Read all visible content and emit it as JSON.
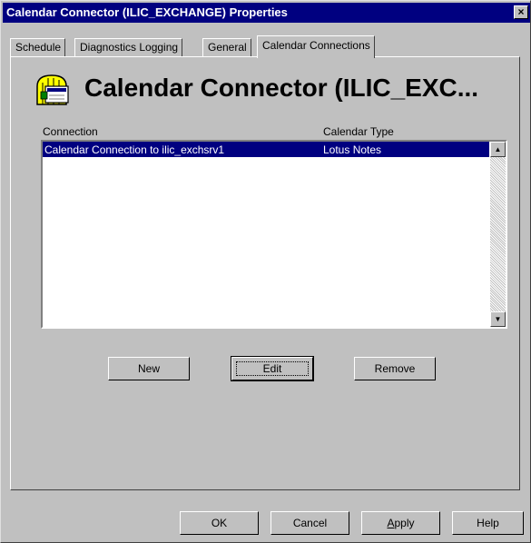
{
  "window": {
    "title": "Calendar Connector (ILIC_EXCHANGE) Properties",
    "close_glyph": "×"
  },
  "tabs": [
    {
      "label": "Schedule"
    },
    {
      "label": "Diagnostics Logging"
    },
    {
      "label": "General"
    },
    {
      "label": "Calendar Connections",
      "active": true
    }
  ],
  "header": {
    "title": "Calendar Connector (ILIC_EXC...",
    "icon": "calendar-connector-icon"
  },
  "list": {
    "columns": [
      "Connection",
      "Calendar Type"
    ],
    "rows": [
      {
        "connection": "Calendar Connection to ilic_exchsrv1",
        "type": "Lotus Notes",
        "selected": true
      }
    ],
    "scroll_up": "▲",
    "scroll_down": "▼"
  },
  "actions": {
    "new": "New",
    "edit": "Edit",
    "remove": "Remove"
  },
  "footer": {
    "ok": "OK",
    "cancel": "Cancel",
    "apply_accel": "A",
    "apply_rest": "pply",
    "help": "Help"
  },
  "colors": {
    "titlebar": "#000080",
    "face": "#c0c0c0",
    "selection": "#000080"
  }
}
